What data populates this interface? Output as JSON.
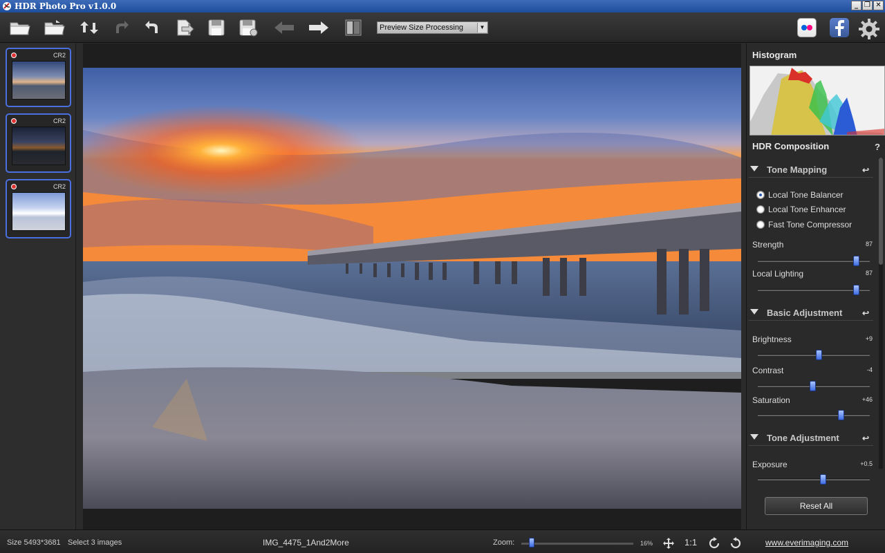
{
  "window": {
    "title": "HDR Photo Pro v1.0.0",
    "controls": [
      "_",
      "❐",
      "✕"
    ]
  },
  "toolbar": {
    "buttons": [
      {
        "name": "open-folder-icon"
      },
      {
        "name": "open-file-icon"
      },
      {
        "name": "refresh-icon"
      },
      {
        "name": "redo-icon"
      },
      {
        "name": "undo-icon"
      },
      {
        "name": "export-icon"
      },
      {
        "name": "save-icon"
      },
      {
        "name": "save-as-icon"
      },
      {
        "name": "back-arrow-icon"
      },
      {
        "name": "forward-arrow-icon"
      },
      {
        "name": "compare-icon"
      }
    ],
    "processing_mode": "Preview Size Processing",
    "social": [
      "flickr-icon",
      "facebook-icon",
      "settings-gear-icon"
    ]
  },
  "thumbnails": [
    {
      "format": "CR2"
    },
    {
      "format": "CR2"
    },
    {
      "format": "CR2"
    }
  ],
  "panel": {
    "histogram_title": "Histogram",
    "composition_title": "HDR Composition",
    "help": "?",
    "tone_mapping": {
      "title": "Tone Mapping",
      "options": [
        "Local Tone Balancer",
        "Local Tone Enhancer",
        "Fast Tone Compressor"
      ],
      "selected": "Local Tone Balancer",
      "sliders": [
        {
          "label": "Strength",
          "value": "87"
        },
        {
          "label": "Local Lighting",
          "value": "87"
        }
      ]
    },
    "basic_adjustment": {
      "title": "Basic Adjustment",
      "sliders": [
        {
          "label": "Brightness",
          "value": "+9"
        },
        {
          "label": "Contrast",
          "value": "-4"
        },
        {
          "label": "Saturation",
          "value": "+46"
        }
      ]
    },
    "tone_adjustment": {
      "title": "Tone Adjustment",
      "sliders": [
        {
          "label": "Exposure",
          "value": "+0.5"
        }
      ]
    },
    "reset_all": "Reset All"
  },
  "status": {
    "size": "Size 5493*3681",
    "selection": "Select  3  images",
    "filename": "IMG_4475_1And2More",
    "zoom_label": "Zoom:",
    "zoom_value": "16%",
    "ratio": "1:1",
    "link": "www.everimaging.com"
  }
}
